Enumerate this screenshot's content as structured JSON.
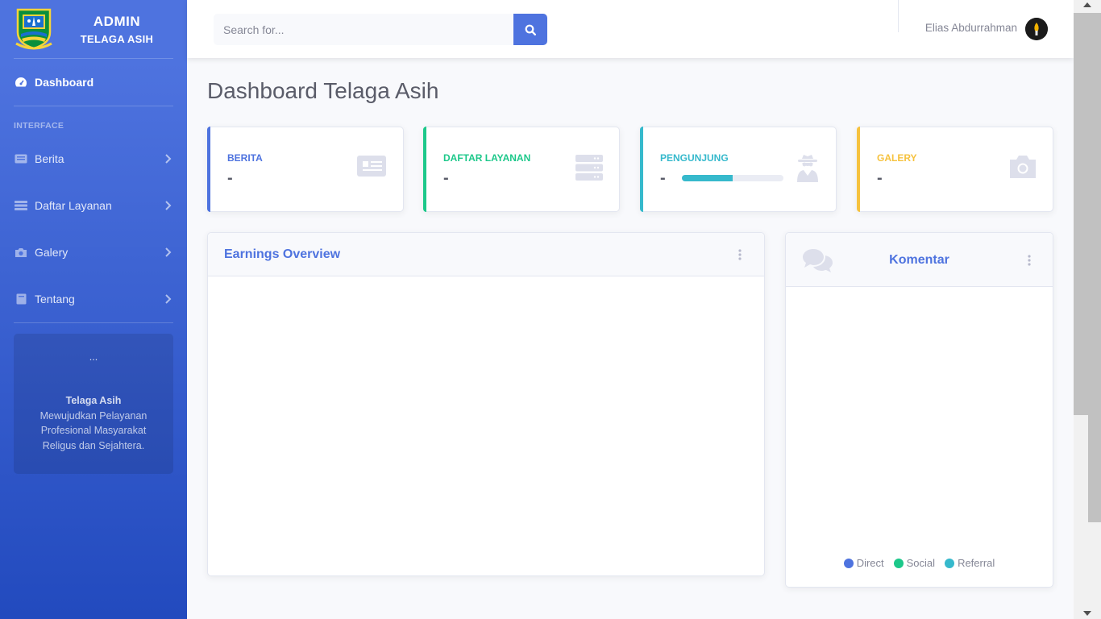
{
  "brand": {
    "title": "ADMIN",
    "subtitle": "TELAGA ASIH"
  },
  "sidebar": {
    "dashboard_label": "Dashboard",
    "section_heading": "INTERFACE",
    "items": [
      {
        "label": "Berita",
        "icon": "newspaper-icon"
      },
      {
        "label": "Daftar Layanan",
        "icon": "server-icon"
      },
      {
        "label": "Galery",
        "icon": "camera-icon"
      },
      {
        "label": "Tentang",
        "icon": "book-icon"
      }
    ],
    "card": {
      "dots": "...",
      "title": "Telaga Asih",
      "text": "Mewujudkan Pelayanan Profesional Masyarakat Religus dan Sejahtera."
    }
  },
  "topbar": {
    "search_placeholder": "Search for...",
    "user_name": "Elias Abdurrahman"
  },
  "page": {
    "title": "Dashboard Telaga Asih"
  },
  "stats": [
    {
      "label": "BERITA",
      "value": "-",
      "color": "#4e73df",
      "icon": "newspaper-icon"
    },
    {
      "label": "DAFTAR LAYANAN",
      "value": "-",
      "color": "#1cc88a",
      "icon": "server-icon"
    },
    {
      "label": "PENGUNJUNG",
      "value": "-",
      "color": "#36b9cc",
      "icon": "user-secret-icon",
      "progress_percent": 50
    },
    {
      "label": "GALERY",
      "value": "-",
      "color": "#f6c23e",
      "icon": "camera-icon"
    }
  ],
  "earnings_panel": {
    "title": "Earnings Overview"
  },
  "comment_panel": {
    "title": "Komentar",
    "legend": [
      {
        "label": "Direct",
        "color": "#4e73df"
      },
      {
        "label": "Social",
        "color": "#1cc88a"
      },
      {
        "label": "Referral",
        "color": "#36b9cc"
      }
    ]
  },
  "colors": {
    "primary": "#4e73df",
    "gray_text": "#5a5c69",
    "muted": "#858796"
  }
}
